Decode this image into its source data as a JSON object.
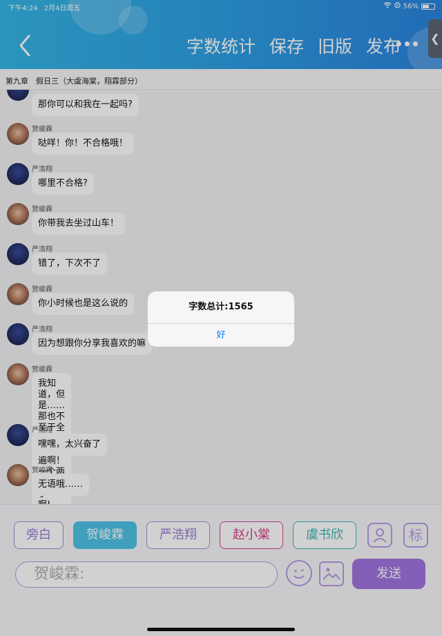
{
  "status": {
    "time": "下午4:24",
    "date": "2月4日周五",
    "battery": "56%",
    "battery_level": 0.56
  },
  "header": {
    "nav": [
      "字数统计",
      "保存",
      "旧版",
      "发布"
    ],
    "side_tab": "❮"
  },
  "chapter": "第九章　假日三（大虞海棠，翔霖部分）",
  "messages": [
    {
      "name": "",
      "text": "那你可以和我在一起吗?",
      "avatar": "yan"
    },
    {
      "name": "贺峻霖",
      "text": "哒咩！你！不合格哦！",
      "avatar": "he"
    },
    {
      "name": "严浩翔",
      "text": "哪里不合格?",
      "avatar": "yan"
    },
    {
      "name": "贺峻霖",
      "text": "你带我去坐过山车！",
      "avatar": "he"
    },
    {
      "name": "严浩翔",
      "text": "错了，下次不了",
      "avatar": "yan"
    },
    {
      "name": "贺峻霖",
      "text": "你小时候也是这么说的",
      "avatar": "he"
    },
    {
      "name": "严浩翔",
      "text": "因为想跟你分享我喜欢的嘛",
      "avatar": "yan"
    },
    {
      "name": "贺峻霖",
      "text": "我知道，但是……那也不至于全部\n都坐一遍啊！一个两个就够了\n啊!",
      "avatar": "he"
    },
    {
      "name": "严浩翔",
      "text": "嘿嘿，太兴奋了",
      "avatar": "yan"
    },
    {
      "name": "贺峻霖",
      "text": "无语哦……",
      "avatar": "he"
    }
  ],
  "characters": [
    "旁白",
    "贺峻霖",
    "严浩翔",
    "赵小棠",
    "虞书欣"
  ],
  "tools": {
    "role_icon": "person-icon",
    "tag_label": "标"
  },
  "input": {
    "placeholder": "贺峻霖:"
  },
  "send_label": "发送",
  "alert": {
    "title": "字数总计:1565",
    "ok": "好"
  }
}
